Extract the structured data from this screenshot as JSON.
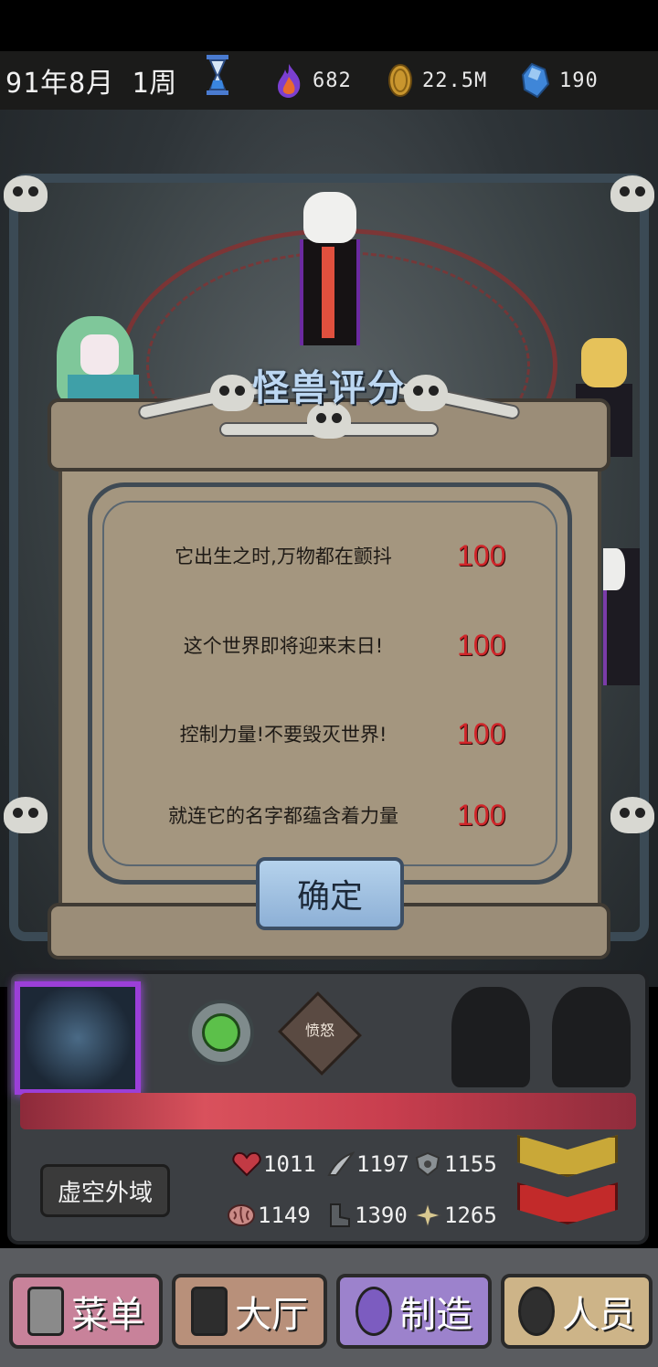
{
  "top_bar": {
    "date": "91年8月 1周",
    "flame_value": "682",
    "coin_value": "22.5M",
    "gem_value": "190",
    "icons": [
      "hourglass-icon",
      "flame-icon",
      "coin-icon",
      "gem-icon"
    ]
  },
  "dialog": {
    "title": "怪兽评分",
    "ratings": [
      {
        "text": "它出生之时,万物都在颤抖",
        "score": "100"
      },
      {
        "text": "这个世界即将迎来末日!",
        "score": "100"
      },
      {
        "text": "控制力量!不要毁灭世界!",
        "score": "100"
      },
      {
        "text": "就连它的名字都蕴含着力量",
        "score": "100"
      }
    ],
    "confirm_label": "确定",
    "score_color": "#d0262a"
  },
  "monster_panel": {
    "trait_badge_label": "愤怒",
    "realm_label": "虚空外域",
    "stats": {
      "hp": "1011",
      "attack": "1197",
      "defense": "1155",
      "intelligence": "1149",
      "speed": "1390",
      "luck": "1265"
    },
    "portrait_glow_color": "#9b3fd8"
  },
  "nav": {
    "menu": "菜单",
    "lobby": "大厅",
    "craft": "制造",
    "staff": "人员"
  }
}
